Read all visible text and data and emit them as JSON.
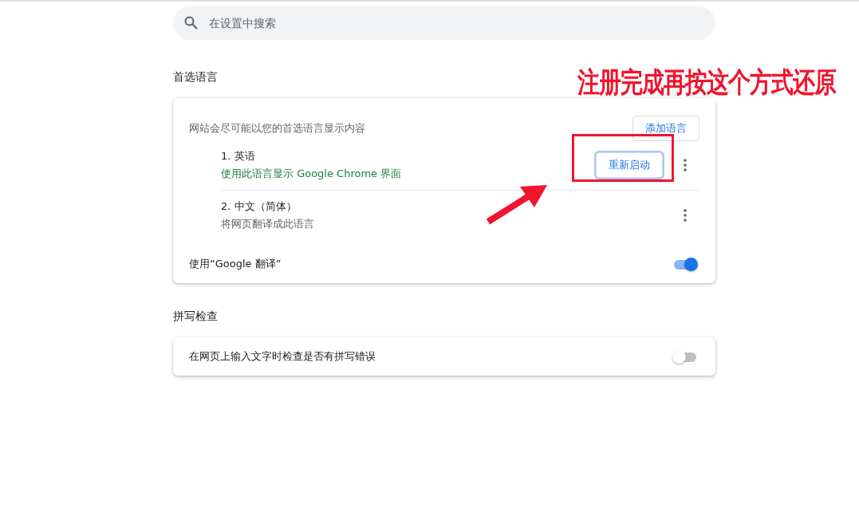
{
  "search": {
    "placeholder": "在设置中搜索"
  },
  "languages_section": {
    "title": "首选语言",
    "description": "网站会尽可能以您的首选语言显示内容",
    "add_button": "添加语言",
    "languages": [
      {
        "label": "1. 英语",
        "note": "使用此语言显示 Google Chrome 界面",
        "ui_language": true,
        "restart_button": "重新启动",
        "highlighted": true
      },
      {
        "label": "2. 中文（简体）",
        "note": "将网页翻译成此语言",
        "ui_language": false,
        "highlighted": false
      }
    ],
    "translate": {
      "label": "使用“Google 翻译”",
      "on": true
    }
  },
  "spellcheck_section": {
    "title": "拼写检查",
    "setting": {
      "label": "在网页上输入文字时检查是否有拼写错误",
      "on": false
    }
  },
  "annotation": {
    "text": "注册完成再按这个方式还原"
  }
}
